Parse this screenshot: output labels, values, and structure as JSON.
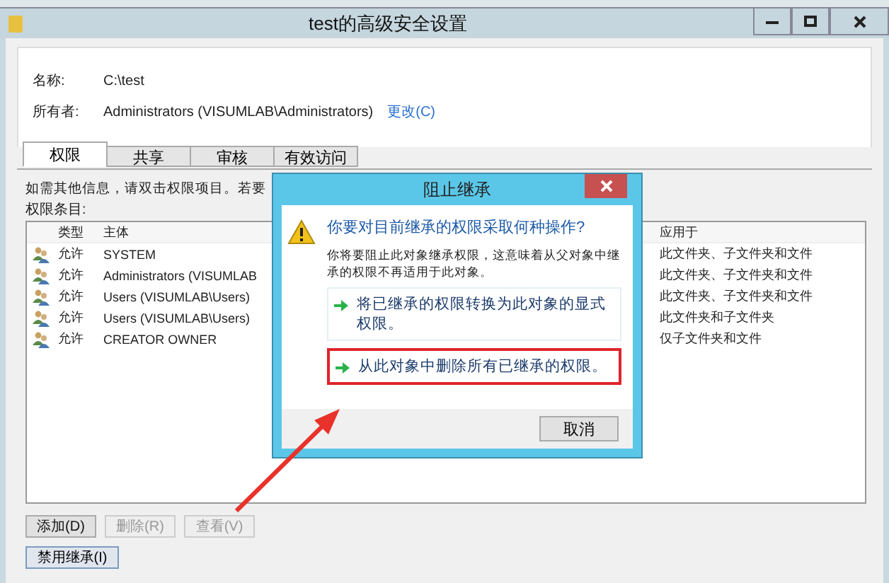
{
  "window": {
    "title": "test的高级安全设置"
  },
  "name_field": {
    "label": "名称:",
    "value": "C:\\test"
  },
  "owner_field": {
    "label": "所有者:",
    "value": "Administrators (VISUMLAB\\Administrators)",
    "link": "更改(C)"
  },
  "tabs": [
    {
      "label": "权限",
      "selected": true
    },
    {
      "label": "共享",
      "selected": false
    },
    {
      "label": "审核",
      "selected": false
    },
    {
      "label": "有效访问",
      "selected": false
    }
  ],
  "instruction": "如需其他信息，请双击权限项目。若要",
  "list_label": "权限条目:",
  "table": {
    "columns": [
      "类型",
      "主体",
      "应用于"
    ],
    "rows": [
      {
        "type": "允许",
        "principal": "SYSTEM",
        "applies_to": "此文件夹、子文件夹和文件"
      },
      {
        "type": "允许",
        "principal": "Administrators (VISUMLAB",
        "applies_to": "此文件夹、子文件夹和文件"
      },
      {
        "type": "允许",
        "principal": "Users (VISUMLAB\\Users)",
        "applies_to": "此文件夹、子文件夹和文件"
      },
      {
        "type": "允许",
        "principal": "Users (VISUMLAB\\Users)",
        "applies_to": "此文件夹和子文件夹"
      },
      {
        "type": "允许",
        "principal": "CREATOR OWNER",
        "applies_to": "仅子文件夹和文件"
      }
    ]
  },
  "buttons": [
    {
      "label": "添加(D)",
      "disabled": false
    },
    {
      "label": "删除(R)",
      "disabled": true
    },
    {
      "label": "查看(V)",
      "disabled": true
    }
  ],
  "inherit_button": {
    "label": "禁用继承(I)"
  },
  "dialog": {
    "title": "阻止继承",
    "heading": "你要对目前继承的权限采取何种操作?",
    "description": "你将要阻止此对象继承权限，这意味着从父对象中继承的权限不再适用于此对象。",
    "options": [
      {
        "label": "将已继承的权限转换为此对象的显式权限。",
        "highlighted": false
      },
      {
        "label": "从此对象中删除所有已继承的权限。",
        "highlighted": true
      }
    ],
    "cancel": "取消"
  }
}
